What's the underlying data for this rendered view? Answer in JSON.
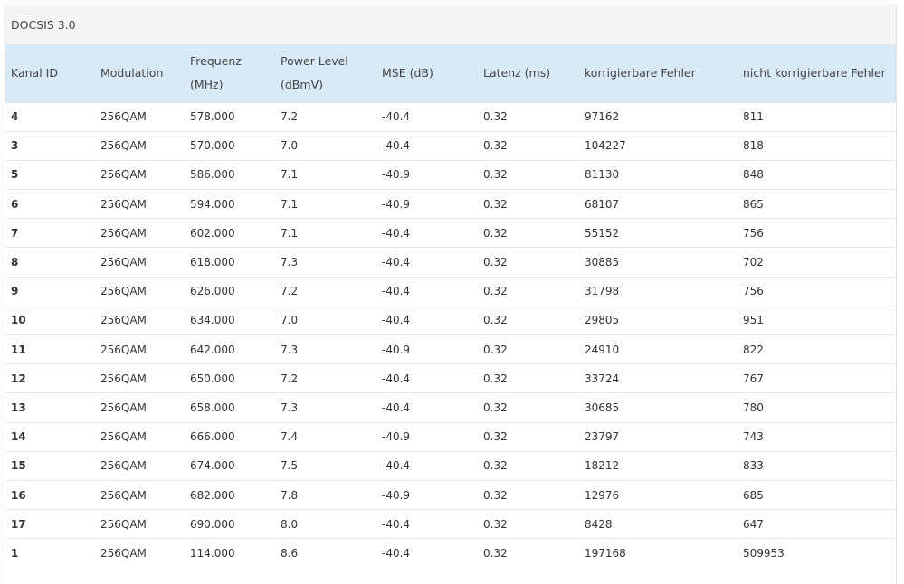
{
  "panel": {
    "title": "DOCSIS 3.0"
  },
  "table": {
    "headers": [
      {
        "line1": "Kanal ID",
        "line2": ""
      },
      {
        "line1": "Modulation",
        "line2": ""
      },
      {
        "line1": "Frequenz (MHz)",
        "line2": ""
      },
      {
        "line1": "Power Level",
        "line2": "(dBmV)"
      },
      {
        "line1": "MSE (dB)",
        "line2": ""
      },
      {
        "line1": "Latenz (ms)",
        "line2": ""
      },
      {
        "line1": "korrigierbare Fehler",
        "line2": ""
      },
      {
        "line1": "nicht korrigierbare Fehler",
        "line2": ""
      }
    ],
    "rows": [
      [
        "4",
        "256QAM",
        "578.000",
        "7.2",
        "-40.4",
        "0.32",
        "97162",
        "811"
      ],
      [
        "3",
        "256QAM",
        "570.000",
        "7.0",
        "-40.4",
        "0.32",
        "104227",
        "818"
      ],
      [
        "5",
        "256QAM",
        "586.000",
        "7.1",
        "-40.9",
        "0.32",
        "81130",
        "848"
      ],
      [
        "6",
        "256QAM",
        "594.000",
        "7.1",
        "-40.9",
        "0.32",
        "68107",
        "865"
      ],
      [
        "7",
        "256QAM",
        "602.000",
        "7.1",
        "-40.4",
        "0.32",
        "55152",
        "756"
      ],
      [
        "8",
        "256QAM",
        "618.000",
        "7.3",
        "-40.4",
        "0.32",
        "30885",
        "702"
      ],
      [
        "9",
        "256QAM",
        "626.000",
        "7.2",
        "-40.4",
        "0.32",
        "31798",
        "756"
      ],
      [
        "10",
        "256QAM",
        "634.000",
        "7.0",
        "-40.4",
        "0.32",
        "29805",
        "951"
      ],
      [
        "11",
        "256QAM",
        "642.000",
        "7.3",
        "-40.9",
        "0.32",
        "24910",
        "822"
      ],
      [
        "12",
        "256QAM",
        "650.000",
        "7.2",
        "-40.4",
        "0.32",
        "33724",
        "767"
      ],
      [
        "13",
        "256QAM",
        "658.000",
        "7.3",
        "-40.4",
        "0.32",
        "30685",
        "780"
      ],
      [
        "14",
        "256QAM",
        "666.000",
        "7.4",
        "-40.9",
        "0.32",
        "23797",
        "743"
      ],
      [
        "15",
        "256QAM",
        "674.000",
        "7.5",
        "-40.4",
        "0.32",
        "18212",
        "833"
      ],
      [
        "16",
        "256QAM",
        "682.000",
        "7.8",
        "-40.9",
        "0.32",
        "12976",
        "685"
      ],
      [
        "17",
        "256QAM",
        "690.000",
        "8.0",
        "-40.4",
        "0.32",
        "8428",
        "647"
      ],
      [
        "1",
        "256QAM",
        "114.000",
        "8.6",
        "-40.4",
        "0.32",
        "197168",
        "509953"
      ]
    ]
  },
  "colors": {
    "header_background": "#d9eaf7",
    "panel_heading_background": "#f5f5f3"
  }
}
